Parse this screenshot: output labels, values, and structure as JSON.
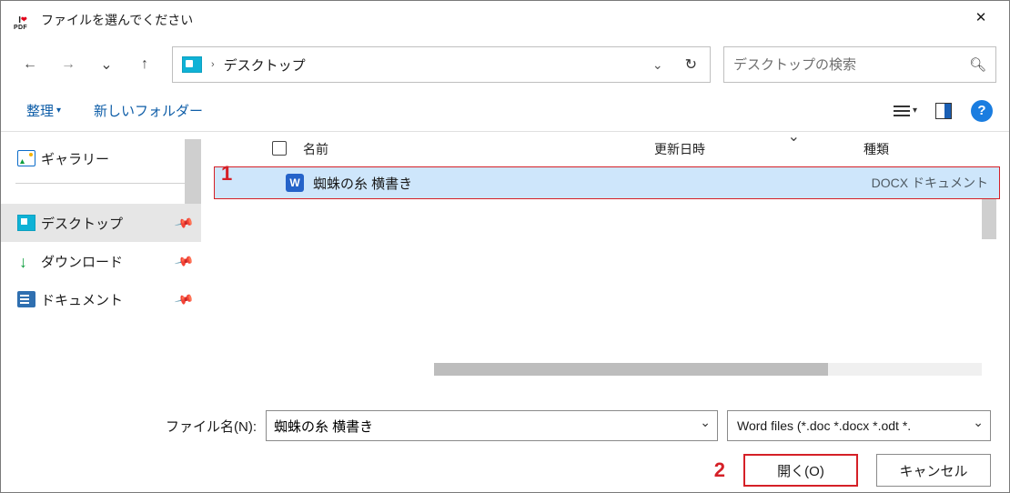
{
  "window": {
    "title": "ファイルを選んでください"
  },
  "address": {
    "location": "デスクトップ"
  },
  "search": {
    "placeholder": "デスクトップの検索"
  },
  "toolbar": {
    "organize": "整理",
    "new_folder": "新しいフォルダー"
  },
  "sidebar": {
    "gallery": "ギャラリー",
    "desktop": "デスクトップ",
    "downloads": "ダウンロード",
    "documents": "ドキュメント"
  },
  "columns": {
    "name": "名前",
    "date": "更新日時",
    "type": "種類"
  },
  "files": [
    {
      "name": "蜘蛛の糸 横書き",
      "date": "",
      "type": "DOCX ドキュメント"
    }
  ],
  "filename": {
    "label": "ファイル名(N):",
    "value": "蜘蛛の糸 横書き"
  },
  "filter": {
    "value": "Word files (*.doc *.docx *.odt *."
  },
  "buttons": {
    "open": "開く(O)",
    "cancel": "キャンセル"
  },
  "annotations": {
    "one": "1",
    "two": "2"
  }
}
